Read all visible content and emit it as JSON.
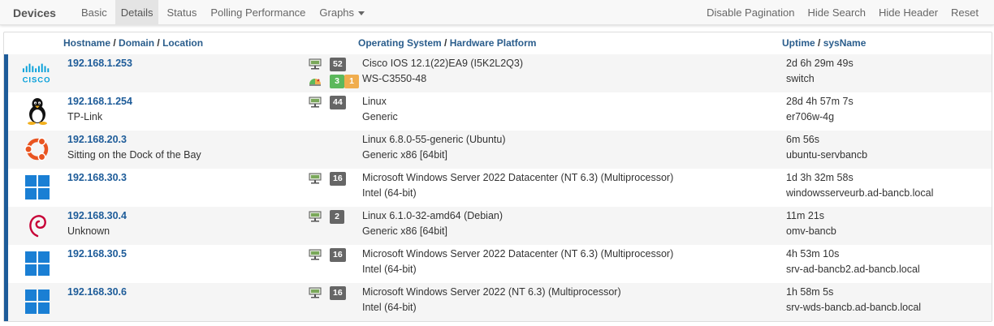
{
  "nav": {
    "brand": "Devices",
    "tabs": [
      "Basic",
      "Details",
      "Status",
      "Polling Performance",
      "Graphs"
    ],
    "active_tab": "Details",
    "actions": [
      "Disable Pagination",
      "Hide Search",
      "Hide Header",
      "Reset"
    ]
  },
  "table": {
    "headers": {
      "hostname": "Hostname",
      "domain": "Domain",
      "location": "Location",
      "os": "Operating System",
      "hw": "Hardware Platform",
      "uptime": "Uptime",
      "sysname": "sysName"
    },
    "rows": [
      {
        "logo": "cisco-logo",
        "hostname": "192.168.1.253",
        "location": "",
        "ports": "52",
        "sensors_ok": "3",
        "sensors_warn": "1",
        "os": "Cisco IOS 12.1(22)EA9 (I5K2L2Q3)",
        "hw": "WS-C3550-48",
        "uptime": "2d 6h 29m 49s",
        "sysname": "switch"
      },
      {
        "logo": "linux-tux-logo",
        "hostname": "192.168.1.254",
        "location": "TP-Link",
        "ports": "44",
        "os": "Linux",
        "hw": "Generic",
        "uptime": "28d 4h 57m 7s",
        "sysname": "er706w-4g"
      },
      {
        "logo": "ubuntu-logo",
        "hostname": "192.168.20.3",
        "location": "Sitting on the Dock of the Bay",
        "ports": "",
        "os": "Linux 6.8.0-55-generic (Ubuntu)",
        "hw": "Generic x86 [64bit]",
        "uptime": "6m 56s",
        "sysname": "ubuntu-servbancb"
      },
      {
        "logo": "windows-logo",
        "hostname": "192.168.30.3",
        "location": "",
        "ports": "16",
        "os": "Microsoft Windows Server 2022 Datacenter (NT 6.3) (Multiprocessor)",
        "hw": "Intel (64-bit)",
        "uptime": "1d 3h 32m 58s",
        "sysname": "windowsserveurb.ad-bancb.local"
      },
      {
        "logo": "debian-logo",
        "hostname": "192.168.30.4",
        "location": "Unknown",
        "ports": "2",
        "os": "Linux 6.1.0-32-amd64 (Debian)",
        "hw": "Generic x86 [64bit]",
        "uptime": "11m 21s",
        "sysname": "omv-bancb"
      },
      {
        "logo": "windows-logo",
        "hostname": "192.168.30.5",
        "location": "",
        "ports": "16",
        "os": "Microsoft Windows Server 2022 Datacenter (NT 6.3) (Multiprocessor)",
        "hw": "Intel (64-bit)",
        "uptime": "4h 53m 10s",
        "sysname": "srv-ad-bancb2.ad-bancb.local"
      },
      {
        "logo": "windows-logo",
        "hostname": "192.168.30.6",
        "location": "",
        "ports": "16",
        "os": "Microsoft Windows Server 2022 (NT 6.3) (Multiprocessor)",
        "hw": "Intel (64-bit)",
        "uptime": "1h 58m 5s",
        "sysname": "srv-wds-bancb.ad-bancb.local"
      }
    ]
  },
  "colors": {
    "link": "#1e5c99",
    "accent_bar": "#1e5c99",
    "badge_grey": "#666666",
    "badge_green": "#5cb85c",
    "badge_orange": "#f0ad4e",
    "windows_blue": "#1a7fd4",
    "ubuntu_orange": "#e95420",
    "debian_red": "#c70036",
    "cisco_blue": "#049fd9"
  }
}
